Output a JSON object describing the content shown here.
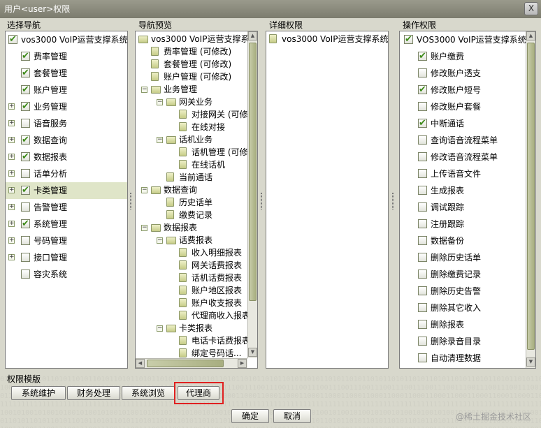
{
  "window": {
    "title": "用户<user>权限",
    "close_glyph": "X"
  },
  "panels": {
    "select_nav": "选择导航",
    "nav_preview": "导航预览",
    "detail_perm": "详细权限",
    "operation_perm": "操作权限"
  },
  "select_nav": [
    {
      "label": "vos3000 VoIP运营支撑系统",
      "checked": true,
      "depth": 0,
      "expander": false
    },
    {
      "label": "费率管理",
      "checked": true,
      "depth": 1,
      "expander": false
    },
    {
      "label": "套餐管理",
      "checked": true,
      "depth": 1,
      "expander": false
    },
    {
      "label": "账户管理",
      "checked": true,
      "depth": 1,
      "expander": false
    },
    {
      "label": "业务管理",
      "checked": true,
      "depth": 1,
      "expander": true
    },
    {
      "label": "语音服务",
      "checked": false,
      "depth": 1,
      "expander": true
    },
    {
      "label": "数据查询",
      "checked": true,
      "depth": 1,
      "expander": true
    },
    {
      "label": "数据报表",
      "checked": true,
      "depth": 1,
      "expander": true
    },
    {
      "label": "话单分析",
      "checked": false,
      "depth": 1,
      "expander": true
    },
    {
      "label": "卡类管理",
      "checked": true,
      "depth": 1,
      "expander": true,
      "selected": true
    },
    {
      "label": "告警管理",
      "checked": false,
      "depth": 1,
      "expander": true
    },
    {
      "label": "系统管理",
      "checked": true,
      "depth": 1,
      "expander": true
    },
    {
      "label": "号码管理",
      "checked": false,
      "depth": 1,
      "expander": true
    },
    {
      "label": "接口管理",
      "checked": false,
      "depth": 1,
      "expander": true
    },
    {
      "label": "容灾系统",
      "checked": false,
      "depth": 1,
      "expander": false
    }
  ],
  "nav_preview": [
    {
      "label": "vos3000 VoIP运营支撑系...",
      "depth": 0,
      "type": "folder"
    },
    {
      "label": "费率管理 (可修改)",
      "depth": 1,
      "type": "leaf"
    },
    {
      "label": "套餐管理 (可修改)",
      "depth": 1,
      "type": "leaf"
    },
    {
      "label": "账户管理 (可修改)",
      "depth": 1,
      "type": "leaf"
    },
    {
      "label": "业务管理",
      "depth": 1,
      "type": "folder",
      "expander": "−"
    },
    {
      "label": "网关业务",
      "depth": 2,
      "type": "folder",
      "expander": "−"
    },
    {
      "label": "对接网关 (可修",
      "depth": 3,
      "type": "leaf"
    },
    {
      "label": "在线对接",
      "depth": 3,
      "type": "leaf"
    },
    {
      "label": "话机业务",
      "depth": 2,
      "type": "folder",
      "expander": "−"
    },
    {
      "label": "话机管理 (可修",
      "depth": 3,
      "type": "leaf"
    },
    {
      "label": "在线话机",
      "depth": 3,
      "type": "leaf"
    },
    {
      "label": "当前通话",
      "depth": 2,
      "type": "leaf"
    },
    {
      "label": "数据查询",
      "depth": 1,
      "type": "folder",
      "expander": "−"
    },
    {
      "label": "历史话单",
      "depth": 2,
      "type": "leaf"
    },
    {
      "label": "缴费记录",
      "depth": 2,
      "type": "leaf"
    },
    {
      "label": "数据报表",
      "depth": 1,
      "type": "folder",
      "expander": "−"
    },
    {
      "label": "话费报表",
      "depth": 2,
      "type": "folder",
      "expander": "−"
    },
    {
      "label": "收入明细报表",
      "depth": 3,
      "type": "leaf"
    },
    {
      "label": "网关话费报表",
      "depth": 3,
      "type": "leaf"
    },
    {
      "label": "话机话费报表",
      "depth": 3,
      "type": "leaf"
    },
    {
      "label": "账户地区报表",
      "depth": 3,
      "type": "leaf"
    },
    {
      "label": "账户收支报表",
      "depth": 3,
      "type": "leaf"
    },
    {
      "label": "代理商收入报表",
      "depth": 3,
      "type": "leaf"
    },
    {
      "label": "卡类报表",
      "depth": 2,
      "type": "folder",
      "expander": "−"
    },
    {
      "label": "电话卡话费报表",
      "depth": 3,
      "type": "leaf"
    },
    {
      "label": "绑定号码话...",
      "depth": 3,
      "type": "leaf"
    }
  ],
  "detail_perm": [
    {
      "label": "vos3000 VoIP运营支撑系统"
    }
  ],
  "operation_perm": [
    {
      "label": "VOS3000 VoIP运营支撑系统",
      "checked": true,
      "depth": 0
    },
    {
      "label": "账户缴费",
      "checked": true,
      "depth": 1
    },
    {
      "label": "修改账户透支",
      "checked": false,
      "depth": 1
    },
    {
      "label": "修改账户短号",
      "checked": true,
      "depth": 1
    },
    {
      "label": "修改账户套餐",
      "checked": false,
      "depth": 1
    },
    {
      "label": "中断通话",
      "checked": true,
      "depth": 1
    },
    {
      "label": "查询语音流程菜单",
      "checked": false,
      "depth": 1
    },
    {
      "label": "修改语音流程菜单",
      "checked": false,
      "depth": 1
    },
    {
      "label": "上传语音文件",
      "checked": false,
      "depth": 1
    },
    {
      "label": "生成报表",
      "checked": false,
      "depth": 1
    },
    {
      "label": "调试跟踪",
      "checked": false,
      "depth": 1
    },
    {
      "label": "注册跟踪",
      "checked": false,
      "depth": 1
    },
    {
      "label": "数据备份",
      "checked": false,
      "depth": 1
    },
    {
      "label": "删除历史话单",
      "checked": false,
      "depth": 1
    },
    {
      "label": "删除缴费记录",
      "checked": false,
      "depth": 1
    },
    {
      "label": "删除历史告警",
      "checked": false,
      "depth": 1
    },
    {
      "label": "删除其它收入",
      "checked": false,
      "depth": 1
    },
    {
      "label": "删除报表",
      "checked": false,
      "depth": 1
    },
    {
      "label": "删除录音目录",
      "checked": false,
      "depth": 1
    },
    {
      "label": "自动清理数据",
      "checked": false,
      "depth": 1
    }
  ],
  "templates": {
    "title": "权限模版",
    "buttons": [
      "系统维护",
      "财务处理",
      "系统浏览",
      "代理商"
    ]
  },
  "footer": {
    "ok": "确定",
    "cancel": "取消"
  },
  "watermark": "@稀土掘金技术社区"
}
